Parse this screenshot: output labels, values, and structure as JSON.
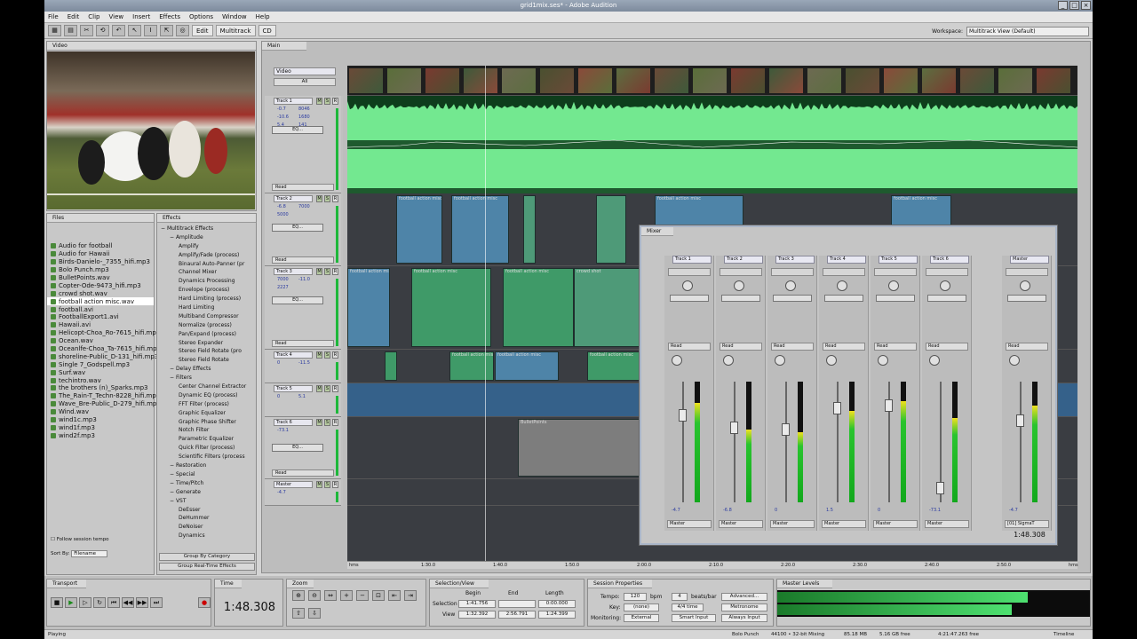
{
  "window": {
    "title": "grid1mix.ses* - Adobe Audition",
    "min": "_",
    "max": "□",
    "close": "×"
  },
  "menu": [
    "File",
    "Edit",
    "Clip",
    "View",
    "Insert",
    "Effects",
    "Options",
    "Window",
    "Help"
  ],
  "toolbar": {
    "edit": "Edit",
    "multitrack": "Multitrack",
    "cd": "CD",
    "workspace_label": "Workspace:",
    "workspace_value": "Multitrack View (Default)"
  },
  "video_panel": {
    "tab": "Video"
  },
  "files_panel": {
    "tab": "Files",
    "files": [
      "Audio for football",
      "Audio for Hawaii",
      "Birds-Danielo-_7355_hifi.mp3",
      "Bolo Punch.mp3",
      "BulletPoints.wav",
      "Copter-Ode-9473_hifi.mp3",
      "crowd shot.wav",
      "football action misc.wav",
      "football.avi",
      "FootballExport1.avi",
      "Hawaii.avi",
      "Helicopt-Choa_Ro-7615_hifi.mp3",
      "Ocean.wav",
      "Oceanlfe-Choa_Ta-7615_hifi.mp3",
      "shoreline-Public_D-131_hifi.mp3",
      "Single 7_Godspell.mp3",
      "Surf.wav",
      "techintro.wav",
      "the brothers (n)_Sparks.mp3",
      "The_Rain-T_Techn-8228_hifi.mp3",
      "Wave_Bre-Public_D-279_hifi.mp3",
      "Wind.wav",
      "wind1c.mp3",
      "wind1f.mp3",
      "wind2f.mp3"
    ],
    "follow": "Follow session tempo",
    "sort_label": "Sort By:",
    "sort_value": "Filename"
  },
  "effects_panel": {
    "tab": "Effects",
    "items": [
      {
        "t": "Multitrack Effects",
        "l": 0
      },
      {
        "t": "Amplitude",
        "l": 1
      },
      {
        "t": "Amplify",
        "l": 2
      },
      {
        "t": "Amplify/Fade (process)",
        "l": 2
      },
      {
        "t": "Binaural Auto-Panner (pr",
        "l": 2
      },
      {
        "t": "Channel Mixer",
        "l": 2
      },
      {
        "t": "Dynamics Processing",
        "l": 2
      },
      {
        "t": "Envelope (process)",
        "l": 2
      },
      {
        "t": "Hard Limiting (process)",
        "l": 2
      },
      {
        "t": "Hard Limiting",
        "l": 2
      },
      {
        "t": "Multiband Compressor",
        "l": 2
      },
      {
        "t": "Normalize (process)",
        "l": 2
      },
      {
        "t": "Pan/Expand (process)",
        "l": 2
      },
      {
        "t": "Stereo Expander",
        "l": 2
      },
      {
        "t": "Stereo Field Rotate (pro",
        "l": 2
      },
      {
        "t": "Stereo Field Rotate",
        "l": 2
      },
      {
        "t": "Delay Effects",
        "l": 1
      },
      {
        "t": "Filters",
        "l": 1
      },
      {
        "t": "Center Channel Extractor",
        "l": 2
      },
      {
        "t": "Dynamic EQ (process)",
        "l": 2
      },
      {
        "t": "FFT Filter (process)",
        "l": 2
      },
      {
        "t": "Graphic Equalizer",
        "l": 2
      },
      {
        "t": "Graphic Phase Shifter",
        "l": 2
      },
      {
        "t": "Notch Filter",
        "l": 2
      },
      {
        "t": "Parametric Equalizer",
        "l": 2
      },
      {
        "t": "Quick Filter (process)",
        "l": 2
      },
      {
        "t": "Scientific Filters (process",
        "l": 2
      },
      {
        "t": "Restoration",
        "l": 1
      },
      {
        "t": "Special",
        "l": 1
      },
      {
        "t": "Time/Pitch",
        "l": 1
      },
      {
        "t": "Generate",
        "l": 1
      },
      {
        "t": "VST",
        "l": 1
      },
      {
        "t": "DeEsser",
        "l": 2
      },
      {
        "t": "DeHummer",
        "l": 2
      },
      {
        "t": "DeNoiser",
        "l": 2
      },
      {
        "t": "Dynamics",
        "l": 2
      }
    ],
    "group_category": "Group By Category",
    "group_realtime": "Group Real-Time Effects"
  },
  "main_panel": {
    "tab": "Main",
    "video_label": "Video",
    "video_select": "All"
  },
  "tracks": [
    {
      "name": "Track 1",
      "eq": "EQ...",
      "read": "Read",
      "vals": [
        "-0.7",
        "8046",
        "-10.6",
        "1680",
        "5.4",
        "141"
      ]
    },
    {
      "name": "Track 2",
      "eq": "EQ...",
      "read": "Read",
      "vals": [
        "-6.8",
        "7000",
        "5000"
      ]
    },
    {
      "name": "Track 3",
      "eq": "EQ...",
      "read": "Read",
      "vals": [
        "7000",
        "-11.0",
        "2227"
      ]
    },
    {
      "name": "Track 4",
      "vals": [
        "0",
        "-11.5"
      ]
    },
    {
      "name": "Track 5",
      "vals": [
        "0",
        "5.1"
      ]
    },
    {
      "name": "Track 6",
      "eq": "EQ...",
      "read": "Read",
      "vals": [
        "-73.1"
      ]
    },
    {
      "name": "Master",
      "vals": [
        "-4.7"
      ]
    }
  ],
  "clips": {
    "action": "football action misc",
    "bullet": "BulletPoints",
    "crowd": "crowd shot"
  },
  "ruler": [
    "hms",
    "1:30.0",
    "1:40.0",
    "1:50.0",
    "2:00.0",
    "2:10.0",
    "2:20.0",
    "2:30.0",
    "2:40.0",
    "2:50.0",
    "hms"
  ],
  "mixer": {
    "tab": "Mixer",
    "strips": [
      {
        "name": "Track 1",
        "read": "Read",
        "out": "Master",
        "db": "-4.7",
        "level": 0.82,
        "fader": 0.72
      },
      {
        "name": "Track 2",
        "read": "Read",
        "out": "Master",
        "db": "-6.8",
        "level": 0.6,
        "fader": 0.62
      },
      {
        "name": "Track 3",
        "read": "Read",
        "out": "Master",
        "db": "0",
        "level": 0.58,
        "fader": 0.6
      },
      {
        "name": "Track 4",
        "read": "Read",
        "out": "Master",
        "db": "1.5",
        "level": 0.76,
        "fader": 0.78
      },
      {
        "name": "Track 5",
        "read": "Read",
        "out": "Master",
        "db": "0",
        "level": 0.84,
        "fader": 0.8
      },
      {
        "name": "Track 6",
        "read": "Read",
        "out": "Master",
        "db": "-73.1",
        "level": 0.7,
        "fader": 0.12
      },
      {
        "name": "Master",
        "read": "Read",
        "out": "[01] SigmaT",
        "db": "-4.7",
        "level": 0.8,
        "fader": 0.68
      }
    ],
    "time": "1:48.308"
  },
  "transport": {
    "tab": "Transport"
  },
  "time": {
    "tab": "Time",
    "value": "1:48.308"
  },
  "zoom": {
    "tab": "Zoom"
  },
  "selection": {
    "tab": "Selection/View",
    "begin": "Begin",
    "end": "End",
    "length": "Length",
    "sel_label": "Selection",
    "view_label": "View",
    "sel_begin": "1:41.756",
    "sel_end": "",
    "sel_length": "0:00.000",
    "view_begin": "1:32.392",
    "view_end": "2:56.791",
    "view_length": "1:24.399"
  },
  "session": {
    "tab": "Session Properties",
    "tempo_label": "Tempo:",
    "tempo": "120",
    "bpm": "bpm",
    "beats": "4",
    "beats_label": "beats/bar",
    "key_label": "Key:",
    "key": "(none)",
    "time_sig": "4/4 time",
    "monitoring_label": "Monitoring:",
    "monitoring": "External",
    "advanced": "Advanced...",
    "metronome": "Metronome",
    "smart_input": "Smart Input",
    "always_input": "Always Input"
  },
  "levels": {
    "tab": "Master Levels",
    "left": 0.8,
    "right": 0.75
  },
  "status": {
    "left": "Playing",
    "file": "Bolo Punch",
    "format": "44100 • 32-bit Mixing",
    "mem": "85.18 MB",
    "free": "5.16 GB free",
    "time": "4:21:47.263 free",
    "tl": "Timeline"
  }
}
